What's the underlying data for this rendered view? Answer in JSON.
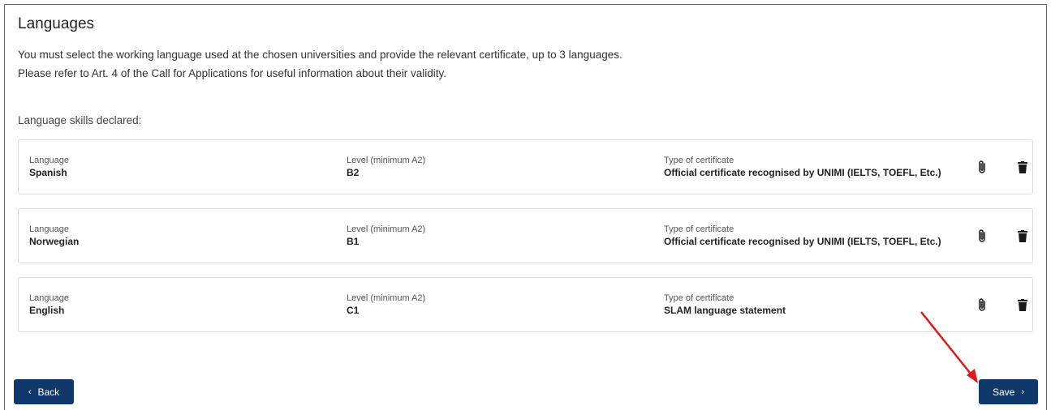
{
  "page": {
    "title": "Languages",
    "description_line1": "You must select the working language used at the chosen universities and provide the relevant certificate, up to 3 languages.",
    "description_line2": "Please refer to Art. 4 of the Call for Applications for useful information about their validity.",
    "declared_label": "Language skills declared:"
  },
  "labels": {
    "language": "Language",
    "level": "Level (minimum A2)",
    "certificate": "Type of certificate"
  },
  "languages": [
    {
      "language": "Spanish",
      "level": "B2",
      "certificate": "Official certificate recognised by UNIMI (IELTS, TOEFL, Etc.)"
    },
    {
      "language": "Norwegian",
      "level": "B1",
      "certificate": "Official certificate recognised by UNIMI (IELTS, TOEFL, Etc.)"
    },
    {
      "language": "English",
      "level": "C1",
      "certificate": "SLAM language statement"
    }
  ],
  "buttons": {
    "back_label": "Back",
    "save_label": "Save"
  },
  "icons": {
    "attach": "paperclip-icon",
    "delete": "trash-icon",
    "back": "chevron-left-icon",
    "save": "chevron-right-icon"
  },
  "colors": {
    "frame_border": "#3a6fb5",
    "button_bg": "#10386b",
    "icon": "#1a1a1a",
    "annotation_arrow": "#e01a1a"
  }
}
